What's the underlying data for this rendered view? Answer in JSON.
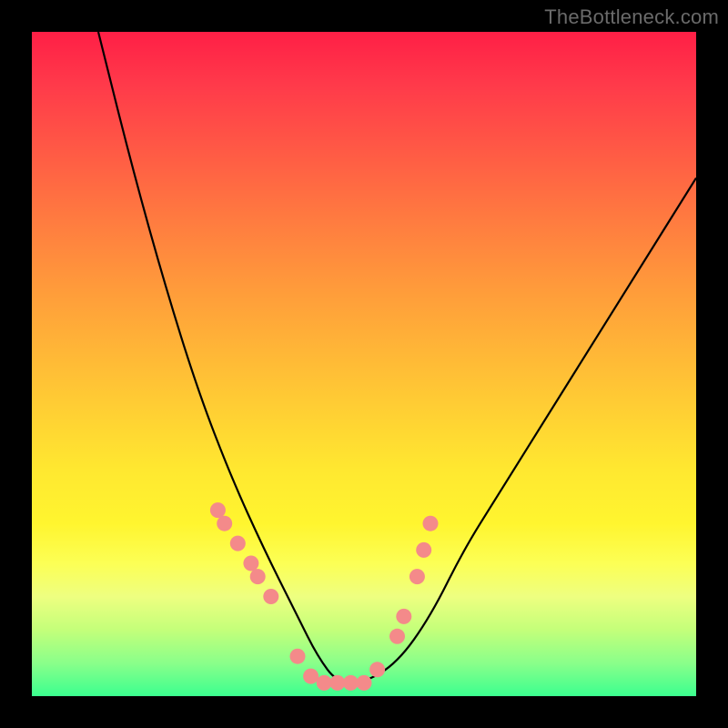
{
  "watermark": "TheBottleneck.com",
  "chart_data": {
    "type": "line",
    "title": "",
    "xlabel": "",
    "ylabel": "",
    "xlim": [
      0,
      100
    ],
    "ylim": [
      0,
      100
    ],
    "series": [
      {
        "name": "bottleneck-curve",
        "x": [
          10,
          15,
          20,
          25,
          30,
          35,
          40,
          43,
          46,
          50,
          55,
          60,
          65,
          70,
          80,
          90,
          100
        ],
        "y": [
          100,
          80,
          62,
          46,
          33,
          22,
          12,
          6,
          2,
          2,
          5,
          12,
          22,
          30,
          46,
          62,
          78
        ]
      }
    ],
    "markers": {
      "name": "highlight-points",
      "color": "#f48a8a",
      "x": [
        28,
        29,
        31,
        33,
        34,
        36,
        40,
        42,
        44,
        46,
        48,
        50,
        52,
        55,
        56,
        58,
        59,
        60
      ],
      "y": [
        28,
        26,
        23,
        20,
        18,
        15,
        6,
        3,
        2,
        2,
        2,
        2,
        4,
        9,
        12,
        18,
        22,
        26
      ]
    },
    "colors": {
      "curve": "#000000",
      "marker": "#f48a8a",
      "gradient_top": "#ff1f46",
      "gradient_bottom": "#3bff8f"
    }
  }
}
